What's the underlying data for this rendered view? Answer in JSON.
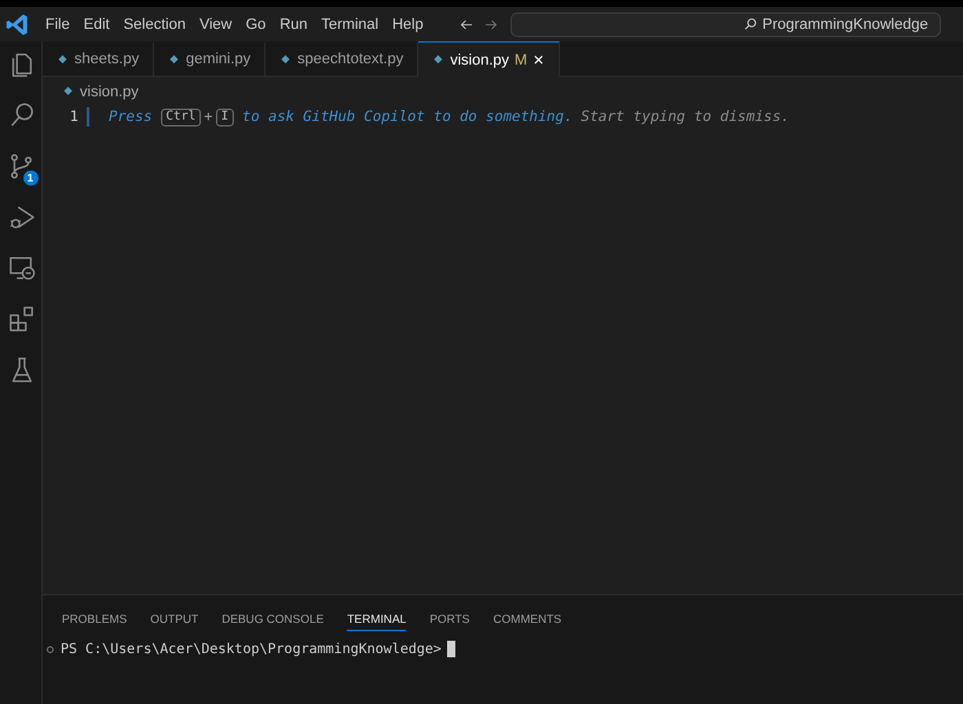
{
  "menu": [
    "File",
    "Edit",
    "Selection",
    "View",
    "Go",
    "Run",
    "Terminal",
    "Help"
  ],
  "command_center": {
    "text": "ProgrammingKnowledge"
  },
  "activity_bar": [
    {
      "kind": "explorer",
      "selected": false
    },
    {
      "kind": "search",
      "selected": false
    },
    {
      "kind": "source-control",
      "selected": false,
      "badge": "1"
    },
    {
      "kind": "run-debug",
      "selected": false
    },
    {
      "kind": "remote",
      "selected": false
    },
    {
      "kind": "extensions",
      "selected": false
    },
    {
      "kind": "testing",
      "selected": false
    }
  ],
  "tabs": [
    {
      "label": "sheets.py",
      "selected": false
    },
    {
      "label": "gemini.py",
      "selected": false
    },
    {
      "label": "speechtotext.py",
      "selected": false
    },
    {
      "label": "vision.py",
      "selected": true,
      "status": "M",
      "closable": true
    }
  ],
  "breadcrumb": "vision.py",
  "editor": {
    "line_number": "1",
    "hint": [
      {
        "kind": "text",
        "text": "Press"
      },
      {
        "kind": "key",
        "text": "Ctrl"
      },
      {
        "kind": "plus",
        "text": "+"
      },
      {
        "kind": "key",
        "text": "I"
      },
      {
        "kind": "text",
        "text": "to ask GitHub Copilot to do something."
      },
      {
        "kind": "muted",
        "text": "Start typing to dismiss."
      }
    ]
  },
  "panel": {
    "tabs": [
      {
        "label": "PROBLEMS",
        "selected": false
      },
      {
        "label": "OUTPUT",
        "selected": false
      },
      {
        "label": "DEBUG CONSOLE",
        "selected": false
      },
      {
        "label": "TERMINAL",
        "selected": true
      },
      {
        "label": "PORTS",
        "selected": false
      },
      {
        "label": "COMMENTS",
        "selected": false
      }
    ],
    "prompt": "PS C:\\Users\\Acer\\Desktop\\ProgrammingKnowledge>"
  }
}
